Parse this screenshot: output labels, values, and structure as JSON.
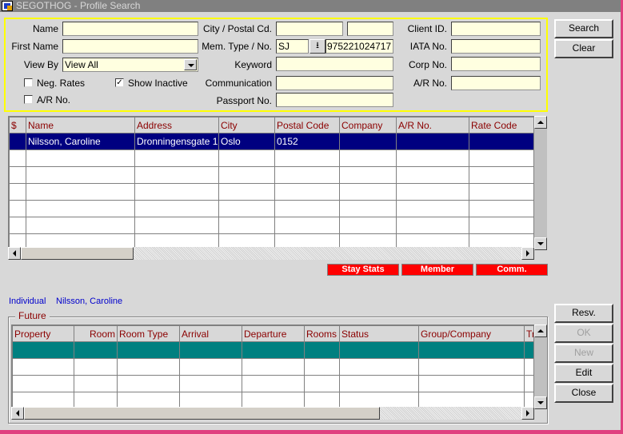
{
  "window": {
    "title": "SEGOTHOG - Profile Search"
  },
  "search": {
    "name_label": "Name",
    "name_value": "",
    "first_name_label": "First Name",
    "first_name_value": "",
    "view_by_label": "View By",
    "view_by_value": "View All",
    "neg_rates_label": "Neg. Rates",
    "neg_rates_checked": false,
    "show_inactive_label": "Show Inactive",
    "show_inactive_checked": true,
    "ar_no_check_label": "A/R No.",
    "ar_no_checked": false,
    "city_postal_label": "City / Postal Cd.",
    "city_value": "",
    "postal_value": "",
    "mem_type_label": "Mem. Type / No.",
    "mem_type_value": "SJ",
    "mem_no_value": "975221024717",
    "keyword_label": "Keyword",
    "keyword_value": "",
    "communication_label": "Communication",
    "communication_value": "",
    "passport_label": "Passport No.",
    "passport_value": "",
    "client_id_label": "Client ID.",
    "client_id_value": "",
    "iata_label": "IATA No.",
    "iata_value": "",
    "corp_label": "Corp No.",
    "corp_value": "",
    "ar_label": "A/R No.",
    "ar_value": ""
  },
  "buttons": {
    "search": "Search",
    "clear": "Clear",
    "resv": "Resv.",
    "ok": "OK",
    "new": "New",
    "edit": "Edit",
    "close": "Close"
  },
  "results": {
    "columns": [
      "$",
      "Name",
      "Address",
      "City",
      "Postal Code",
      "Company",
      "A/R No.",
      "Rate Code"
    ],
    "rows": [
      [
        "",
        "Nilsson, Caroline",
        "Dronningensgate 1",
        "Oslo",
        "0152",
        "",
        "",
        ""
      ]
    ]
  },
  "action_buttons": {
    "stay_stats": "Stay Stats",
    "member": "Member",
    "comm": "Comm."
  },
  "profile_info": {
    "type": "Individual",
    "name": "Nilsson, Caroline"
  },
  "future": {
    "legend": "Future",
    "columns": [
      "Property",
      "Room",
      "Room Type",
      "Arrival",
      "Departure",
      "Rooms",
      "Status",
      "Group/Company",
      "Tr"
    ]
  },
  "colors": {
    "highlight_border": "#ffff00",
    "selected_row": "#000080",
    "future_row": "#008080",
    "action_button": "#ff0000"
  }
}
